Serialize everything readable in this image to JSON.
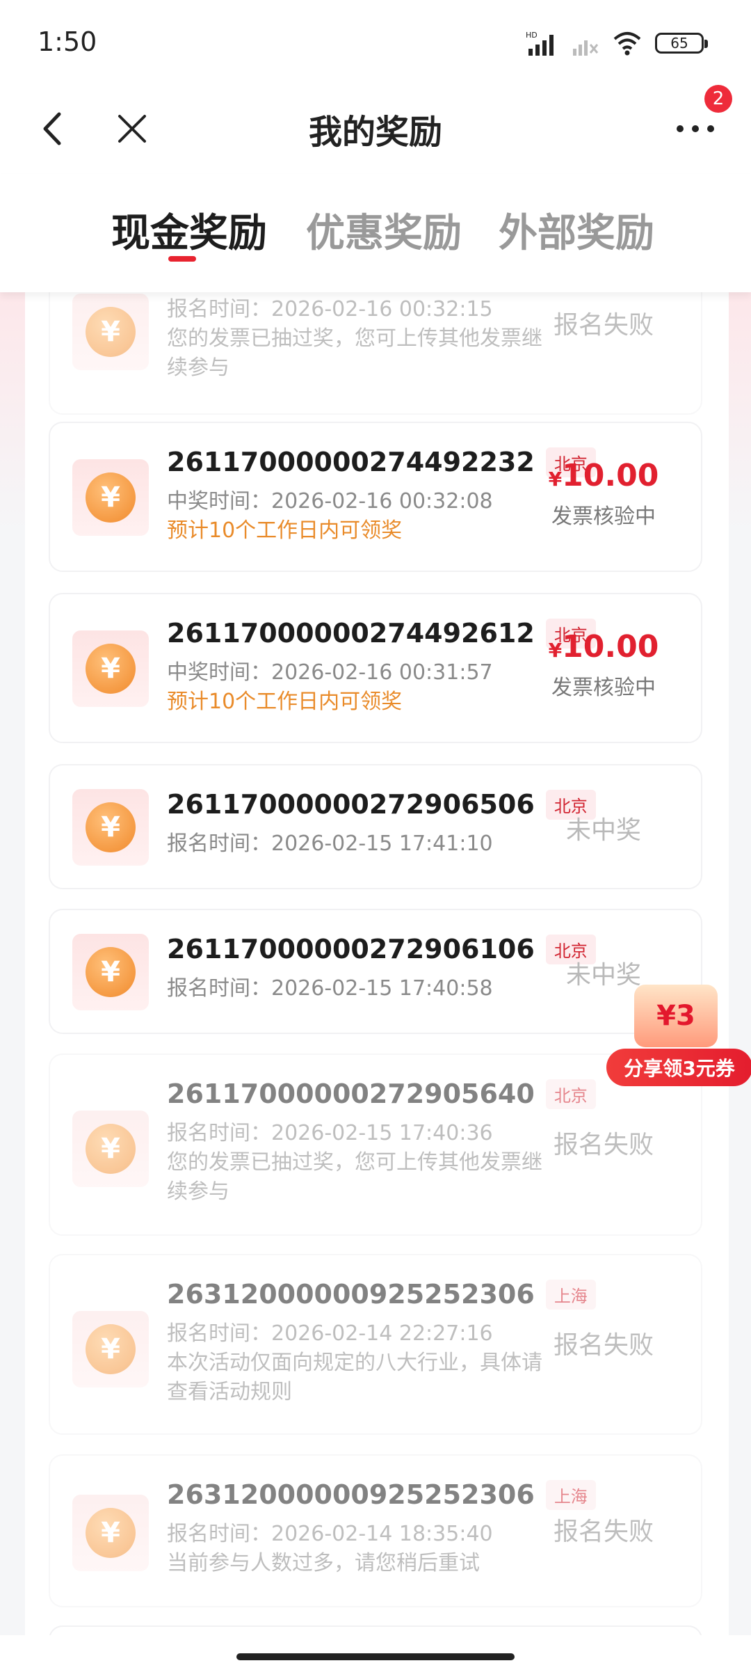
{
  "status_bar": {
    "time": "1:50",
    "battery": "65"
  },
  "navbar": {
    "title": "我的奖励",
    "badge_count": "2"
  },
  "tabs": [
    {
      "label": "现金奖励",
      "active": true
    },
    {
      "label": "优惠奖励",
      "active": false
    },
    {
      "label": "外部奖励",
      "active": false
    }
  ],
  "records": [
    {
      "id": "",
      "region": "",
      "time_line": "报名时间：2026-02-16 00:32:15",
      "note": "您的发票已抽过奖，您可上传其他发票继续参与",
      "status": "报名失败"
    },
    {
      "id": "26117000000274492232",
      "region": "北京",
      "time_line": "中奖时间：2026-02-16 00:32:08",
      "hint": "预计10个工作日内可领奖",
      "amount": "10.00",
      "currency": "¥",
      "status": "发票核验中"
    },
    {
      "id": "26117000000274492612",
      "region": "北京",
      "time_line": "中奖时间：2026-02-16 00:31:57",
      "hint": "预计10个工作日内可领奖",
      "amount": "10.00",
      "currency": "¥",
      "status": "发票核验中"
    },
    {
      "id": "26117000000272906506",
      "region": "北京",
      "time_line": "报名时间：2026-02-15 17:41:10",
      "status": "未中奖"
    },
    {
      "id": "26117000000272906106",
      "region": "北京",
      "time_line": "报名时间：2026-02-15 17:40:58",
      "status": "未中奖"
    },
    {
      "id": "26117000000272905640",
      "region": "北京",
      "time_line": "报名时间：2026-02-15 17:40:36",
      "note": "您的发票已抽过奖，您可上传其他发票继续参与",
      "status": "报名失败"
    },
    {
      "id": "26312000000925252306",
      "region": "上海",
      "time_line": "报名时间：2026-02-14 22:27:16",
      "note": "本次活动仅面向规定的八大行业，具体请查看活动规则",
      "status": "报名失败"
    },
    {
      "id": "26312000000925252306",
      "region": "上海",
      "time_line": "报名时间：2026-02-14 18:35:40",
      "note": "当前参与人数过多，请您稍后重试",
      "status": "报名失败"
    }
  ],
  "promo": {
    "amount_label": "¥3",
    "text": "分享领3元券"
  },
  "colors": {
    "accent": "#e8232f",
    "hint": "#e98b2a",
    "muted": "#b9b9b9"
  }
}
